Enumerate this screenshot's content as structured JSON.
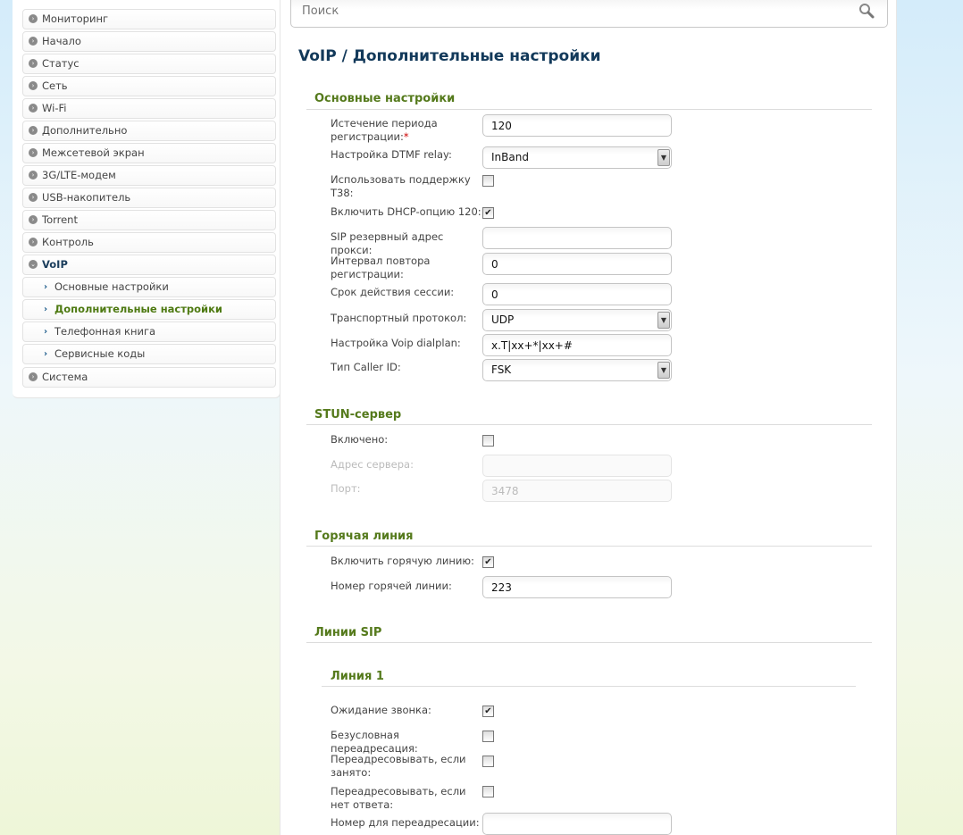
{
  "sidebar": {
    "items": [
      "Мониторинг",
      "Начало",
      "Статус",
      "Сеть",
      "Wi-Fi",
      "Дополнительно",
      "Межсетевой экран",
      "3G/LTE-модем",
      "USB-накопитель",
      "Torrent",
      "Контроль",
      "VoIP"
    ],
    "voip_sub": [
      "Основные настройки",
      "Дополнительные настройки",
      "Телефонная книга",
      "Сервисные коды"
    ],
    "last": "Система"
  },
  "search": {
    "placeholder": "Поиск"
  },
  "title": "VoIP /  Дополнительные настройки",
  "basic": {
    "heading": "Основные настройки",
    "reg_expiry_label": "Истечение периода регистрации:",
    "required_mark": "*",
    "reg_expiry": "120",
    "dtmf_label": "Настройка DTMF relay:",
    "dtmf": "InBand",
    "t38_label": "Использовать поддержку T38:",
    "t38": false,
    "dhcp120_label": "Включить DHCP-опцию 120:",
    "dhcp120": true,
    "proxy_label": "SIP резервный адрес прокси:",
    "proxy": "",
    "retry_label": "Интервал повтора регистрации:",
    "retry": "0",
    "session_label": "Срок действия сессии:",
    "session": "0",
    "transport_label": "Транспортный протокол:",
    "transport": "UDP",
    "dialplan_label": "Настройка Voip dialplan:",
    "dialplan": "x.T|xx+*|xx+#",
    "callerid_label": "Тип Caller ID:",
    "callerid": "FSK"
  },
  "stun": {
    "heading": "STUN-сервер",
    "enabled_label": "Включено:",
    "enabled": false,
    "address_label": "Адрес сервера:",
    "address": "",
    "port_label": "Порт:",
    "port": "3478"
  },
  "hotline": {
    "heading": "Горячая линия",
    "enable_label": "Включить горячую линию:",
    "enable": true,
    "number_label": "Номер горячей линии:",
    "number": "223"
  },
  "sip": {
    "heading": "Линии SIP",
    "line_heading": "Линия 1",
    "waiting_label": "Ожидание звонка:",
    "waiting": true,
    "uncond_label": "Безусловная переадресация:",
    "uncond": false,
    "busy_label": "Переадресовывать, если занято:",
    "busy": false,
    "noanswer_label": "Переадресовывать, если нет ответа:",
    "noanswer": false,
    "fwd_label": "Номер для переадресации:",
    "fwd": ""
  }
}
